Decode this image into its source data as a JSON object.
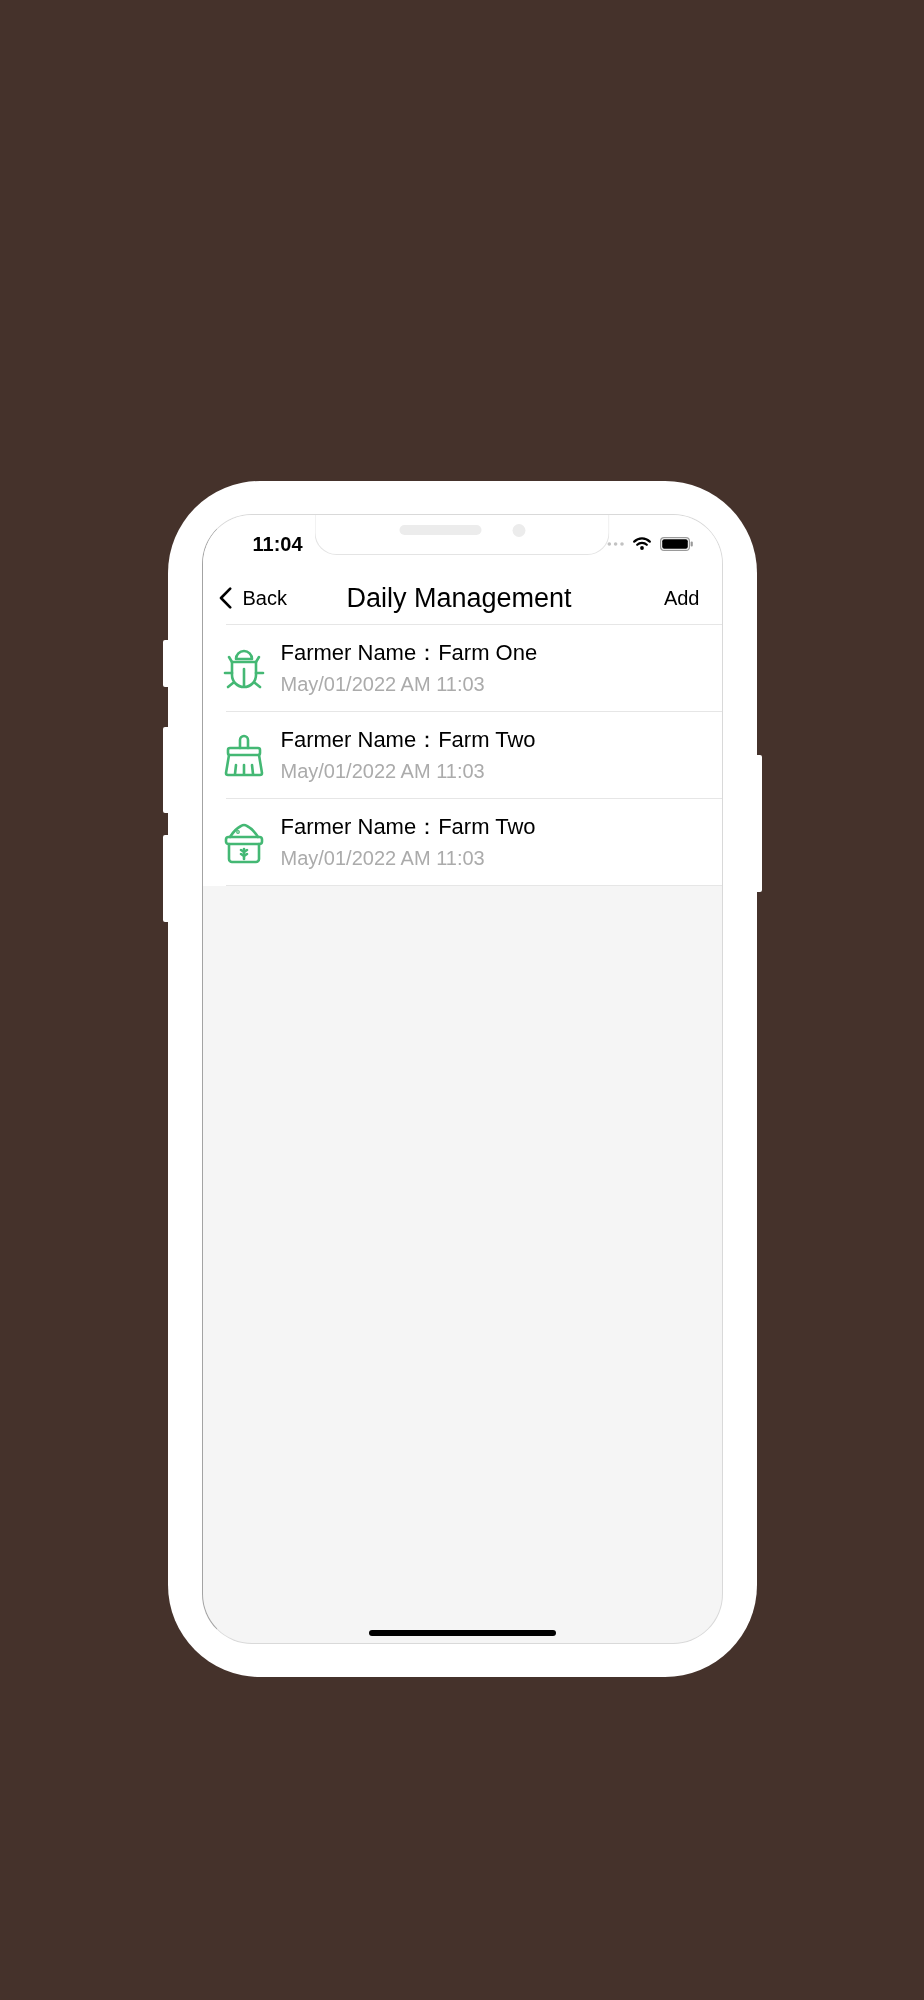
{
  "status_bar": {
    "time": "11:04"
  },
  "nav_bar": {
    "back": "Back",
    "title": "Daily Management",
    "action": "Add"
  },
  "records": [
    {
      "kind": "bug",
      "title": "Farmer Name：Farm One",
      "date": "May/01/2022 AM 11:03"
    },
    {
      "kind": "broom",
      "title": "Farmer Name：Farm Two",
      "date": "May/01/2022 AM 11:03"
    },
    {
      "kind": "sack",
      "title": "Farmer Name：Farm Two",
      "date": "May/01/2022 AM 11:03"
    }
  ]
}
